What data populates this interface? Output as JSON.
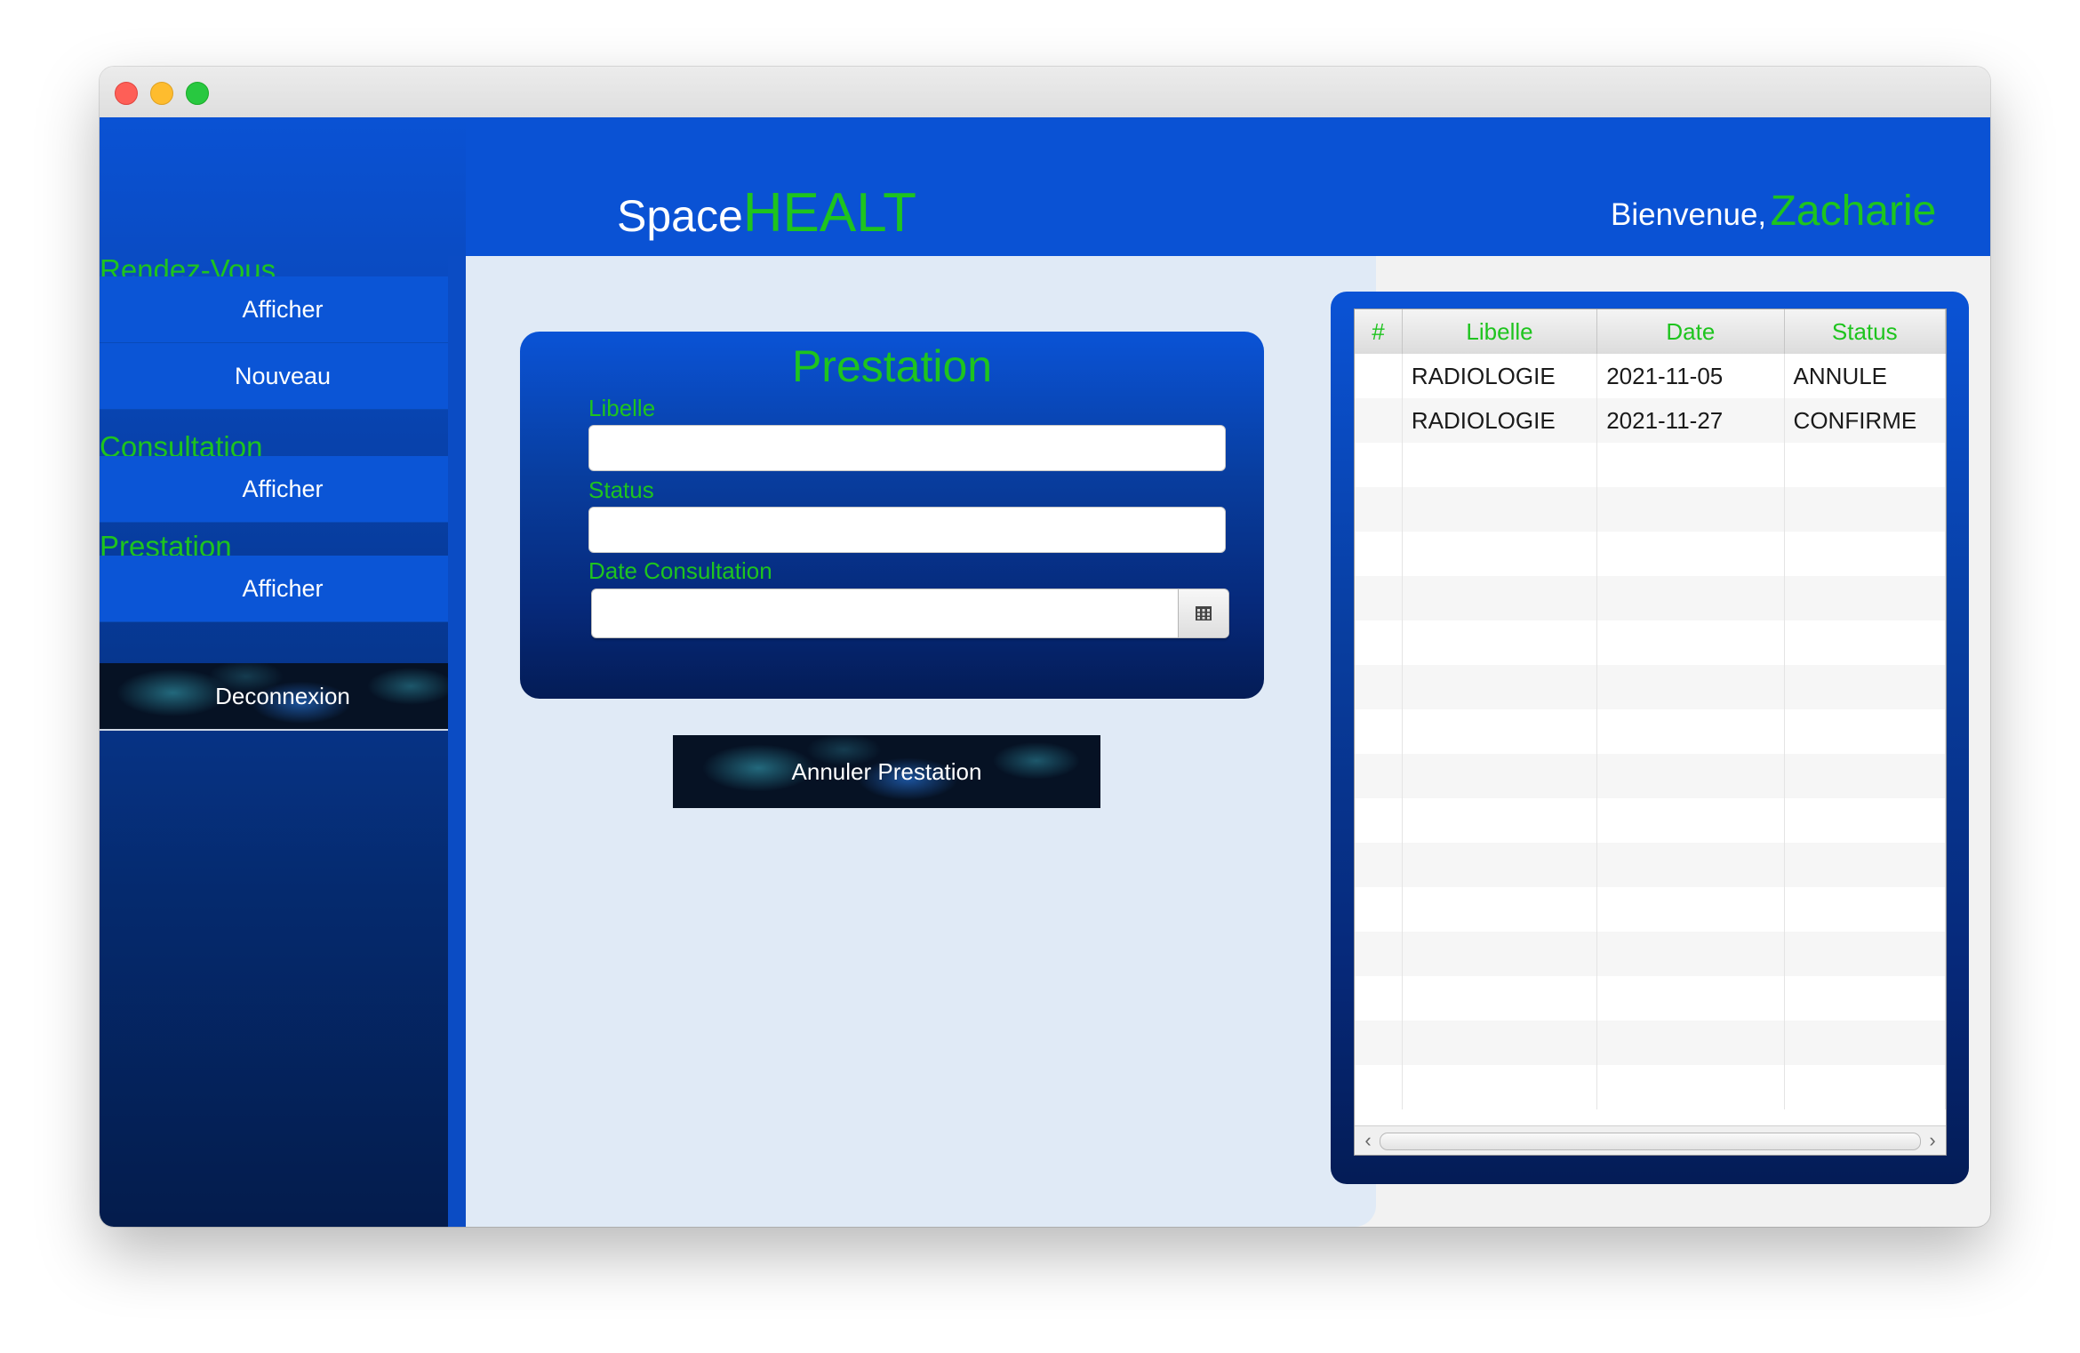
{
  "brand": {
    "space": "Space",
    "healt": "HEALT"
  },
  "welcome": {
    "label": "Bienvenue,",
    "user": "Zacharie"
  },
  "sidebar": {
    "sections": [
      {
        "title": "Rendez-Vous",
        "buttons": [
          "Afficher",
          "Nouveau"
        ]
      },
      {
        "title": "Consultation",
        "buttons": [
          "Afficher"
        ]
      },
      {
        "title": "Prestation",
        "buttons": [
          "Afficher"
        ]
      }
    ],
    "logout": "Deconnexion"
  },
  "form": {
    "title": "Prestation",
    "libelle_label": "Libelle",
    "libelle_value": "",
    "status_label": "Status",
    "status_value": "",
    "date_label": "Date Consultation",
    "date_value": "",
    "cancel_button": "Annuler Prestation"
  },
  "table": {
    "columns": [
      "#",
      "Libelle",
      "Date",
      "Status"
    ],
    "rows": [
      [
        "",
        "RADIOLOGIE",
        "2021-11-05",
        "ANNULE"
      ],
      [
        "",
        "RADIOLOGIE",
        "2021-11-27",
        "CONFIRME"
      ]
    ],
    "empty_rows": 15
  },
  "icons": {
    "calendar": "calendar-icon",
    "scroll_left": "chevron-left-icon",
    "scroll_right": "chevron-right-icon"
  },
  "colors": {
    "primary_blue": "#0a52d4",
    "accent_green": "#1ec41e",
    "panel_light": "#e0eaf6"
  }
}
